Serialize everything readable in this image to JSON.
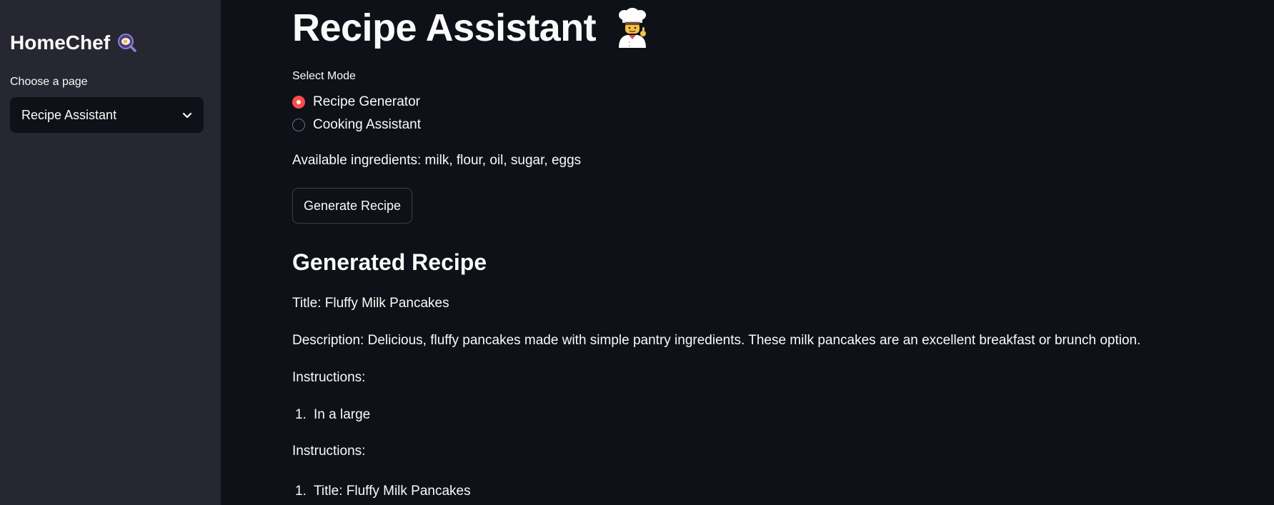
{
  "sidebar": {
    "brand": "HomeChef",
    "brand_icon": "magnifier-egg-icon",
    "page_select_label": "Choose a page",
    "page_select_value": "Recipe Assistant"
  },
  "main": {
    "title": "Recipe Assistant",
    "title_icon": "chef-icon",
    "mode": {
      "label": "Select Mode",
      "options": [
        {
          "label": "Recipe Generator",
          "selected": true
        },
        {
          "label": "Cooking Assistant",
          "selected": false
        }
      ]
    },
    "ingredients_text": "Available ingredients: milk, flour, oil, sugar, eggs",
    "generate_button": "Generate Recipe",
    "generated": {
      "heading": "Generated Recipe",
      "title_line": "Title: Fluffy Milk Pancakes",
      "description_line": "Description: Delicious, fluffy pancakes made with simple pantry ingredients. These milk pancakes are an excellent breakfast or brunch option.",
      "instructions_label_1": "Instructions:",
      "list_1": [
        {
          "num": "1.",
          "text": "In a large"
        }
      ],
      "instructions_label_2": "Instructions:",
      "list_2": [
        {
          "num": "1.",
          "text": "Title: Fluffy Milk Pancakes"
        }
      ]
    }
  },
  "colors": {
    "background": "#0e1117",
    "sidebar": "#262730",
    "accent": "#ff4b4b",
    "text": "#fafafa"
  }
}
